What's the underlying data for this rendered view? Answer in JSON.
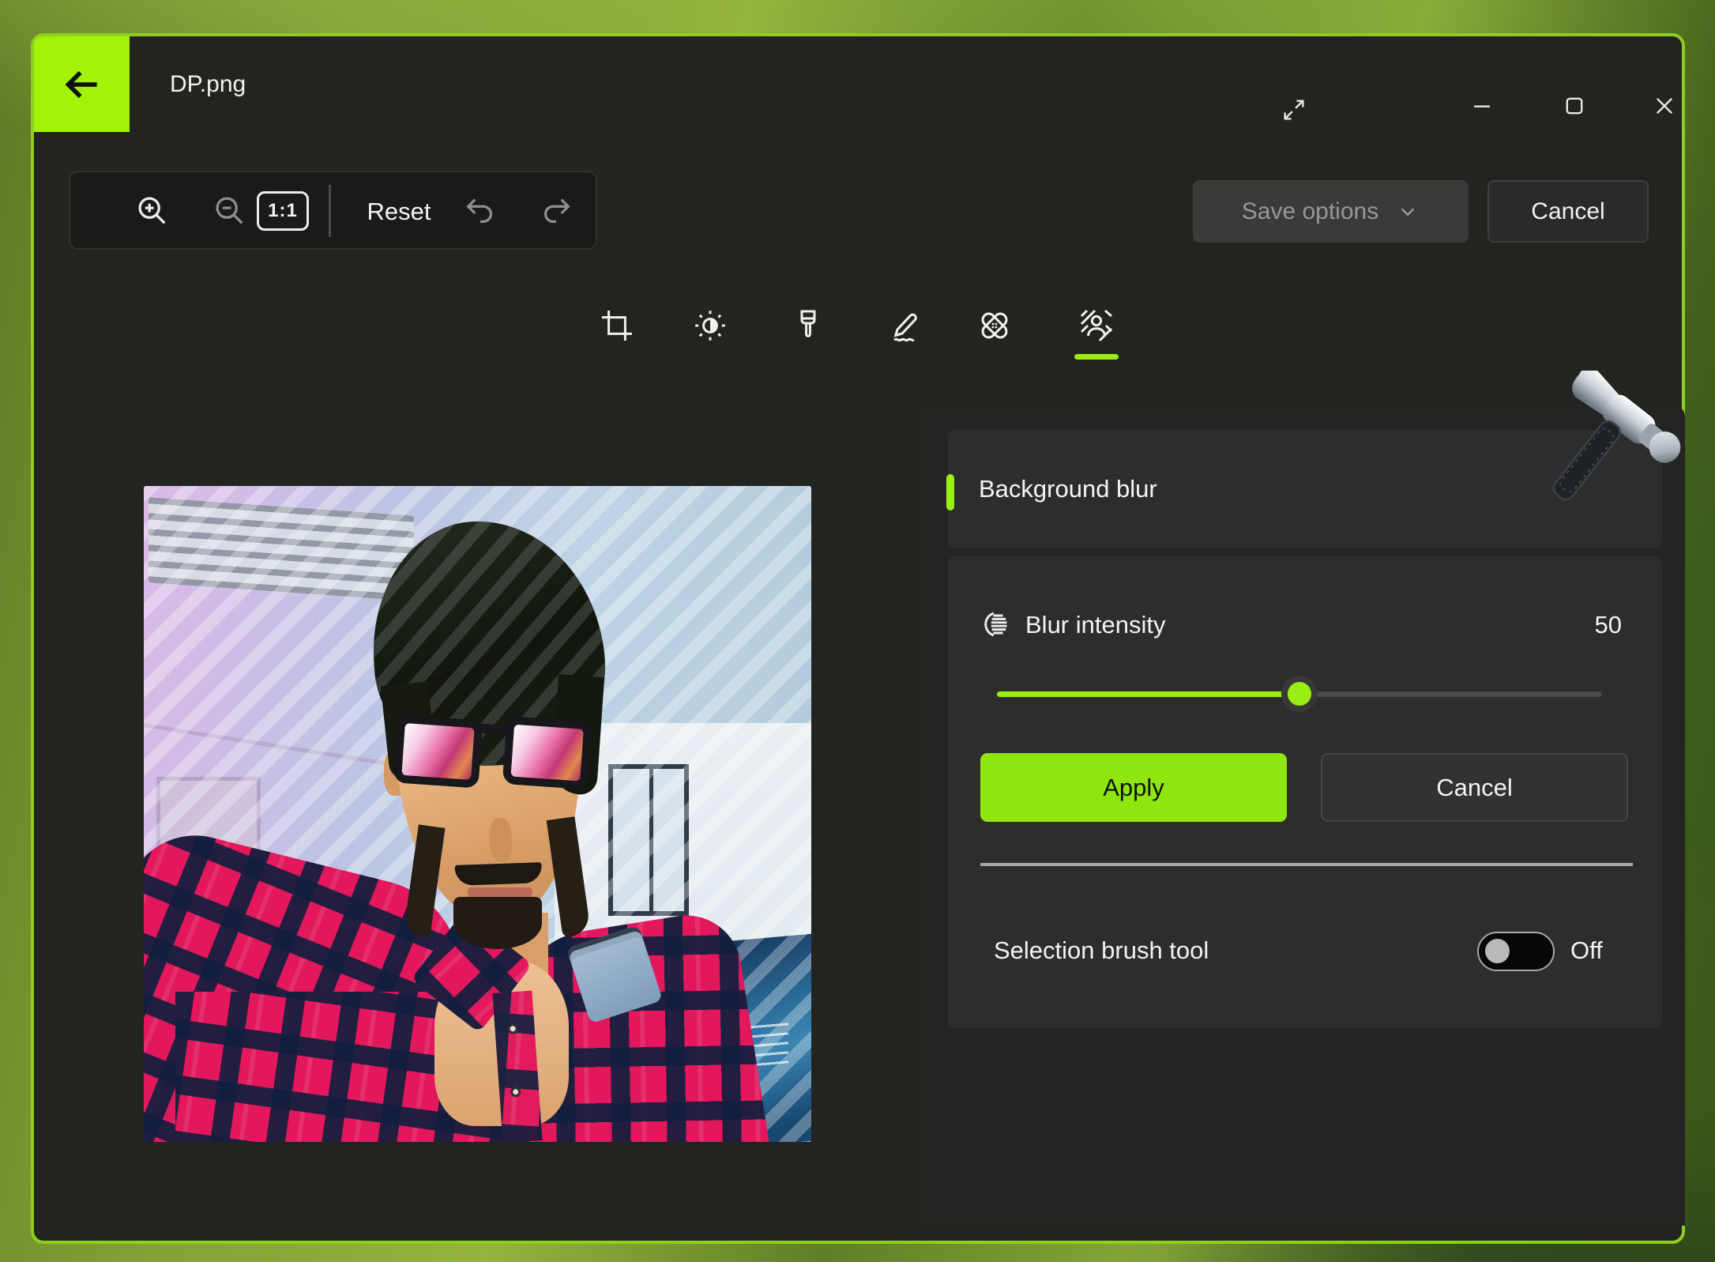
{
  "window": {
    "title": "DP.png",
    "controls": [
      "expand",
      "minimize",
      "maximize",
      "close"
    ]
  },
  "toolbar": {
    "zoom_in": "zoom-in",
    "zoom_out": "zoom-out",
    "ratio_label": "1:1",
    "reset_label": "Reset",
    "undo": "undo",
    "redo": "redo"
  },
  "header_actions": {
    "save_options_label": "Save options",
    "cancel_label": "Cancel",
    "save_options_disabled": true
  },
  "tools": [
    "crop",
    "adjustment",
    "filter",
    "markup",
    "retouch",
    "background-blur"
  ],
  "selected_tool": "background-blur",
  "panel": {
    "title": "Background blur",
    "blur": {
      "label": "Blur intensity",
      "value": "50",
      "percent": 50
    },
    "apply_label": "Apply",
    "cancel_label": "Cancel",
    "brush": {
      "label": "Selection brush tool",
      "state": "Off",
      "enabled": false
    }
  },
  "photo": {
    "filename": "DP.png",
    "overlay": "diagonal-stripe selection mask"
  },
  "colors": {
    "accent_lime": "#9bee14",
    "apply_green": "#8fe60e",
    "window_border": "#8ccf1d",
    "window_bg": "#22241f",
    "panel_bg": "#242424",
    "card_bg": "#2d2d2d"
  }
}
